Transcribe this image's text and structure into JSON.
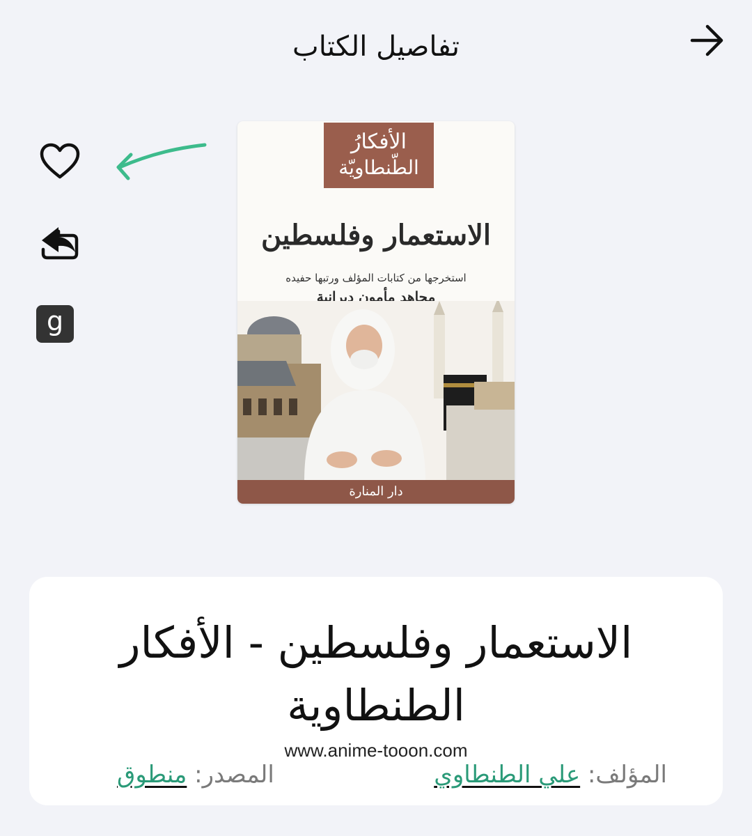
{
  "header": {
    "title": "تفاصيل الكتاب",
    "back_icon": "arrow-right-icon"
  },
  "actions": {
    "favorite_icon": "heart-outline-icon",
    "share_icon": "share-reply-icon",
    "goodreads_letter": "g"
  },
  "annotation": {
    "arrow_color": "#3dbb8c"
  },
  "cover": {
    "series_line1": "الأفكارُ",
    "series_line2": "الطّنطاويّة",
    "title": "الاستعمار وفلسطين",
    "subtitle": "استخرجها من كتابات المؤلف ورتبها حفيده",
    "editor": "مجاهد مأمون ديرانية",
    "publisher": "دار المنارة",
    "series_color": "#9a5e4d"
  },
  "book": {
    "title": "الاستعمار وفلسطين - الأفكار الطنطاوية",
    "watermark": "www.anime-tooon.com",
    "author_label": "المؤلف:",
    "author_name": "علي الطنطاوي",
    "source_label": "المصدر:",
    "source_name": "منطوق",
    "link_color": "#2a9a78"
  }
}
